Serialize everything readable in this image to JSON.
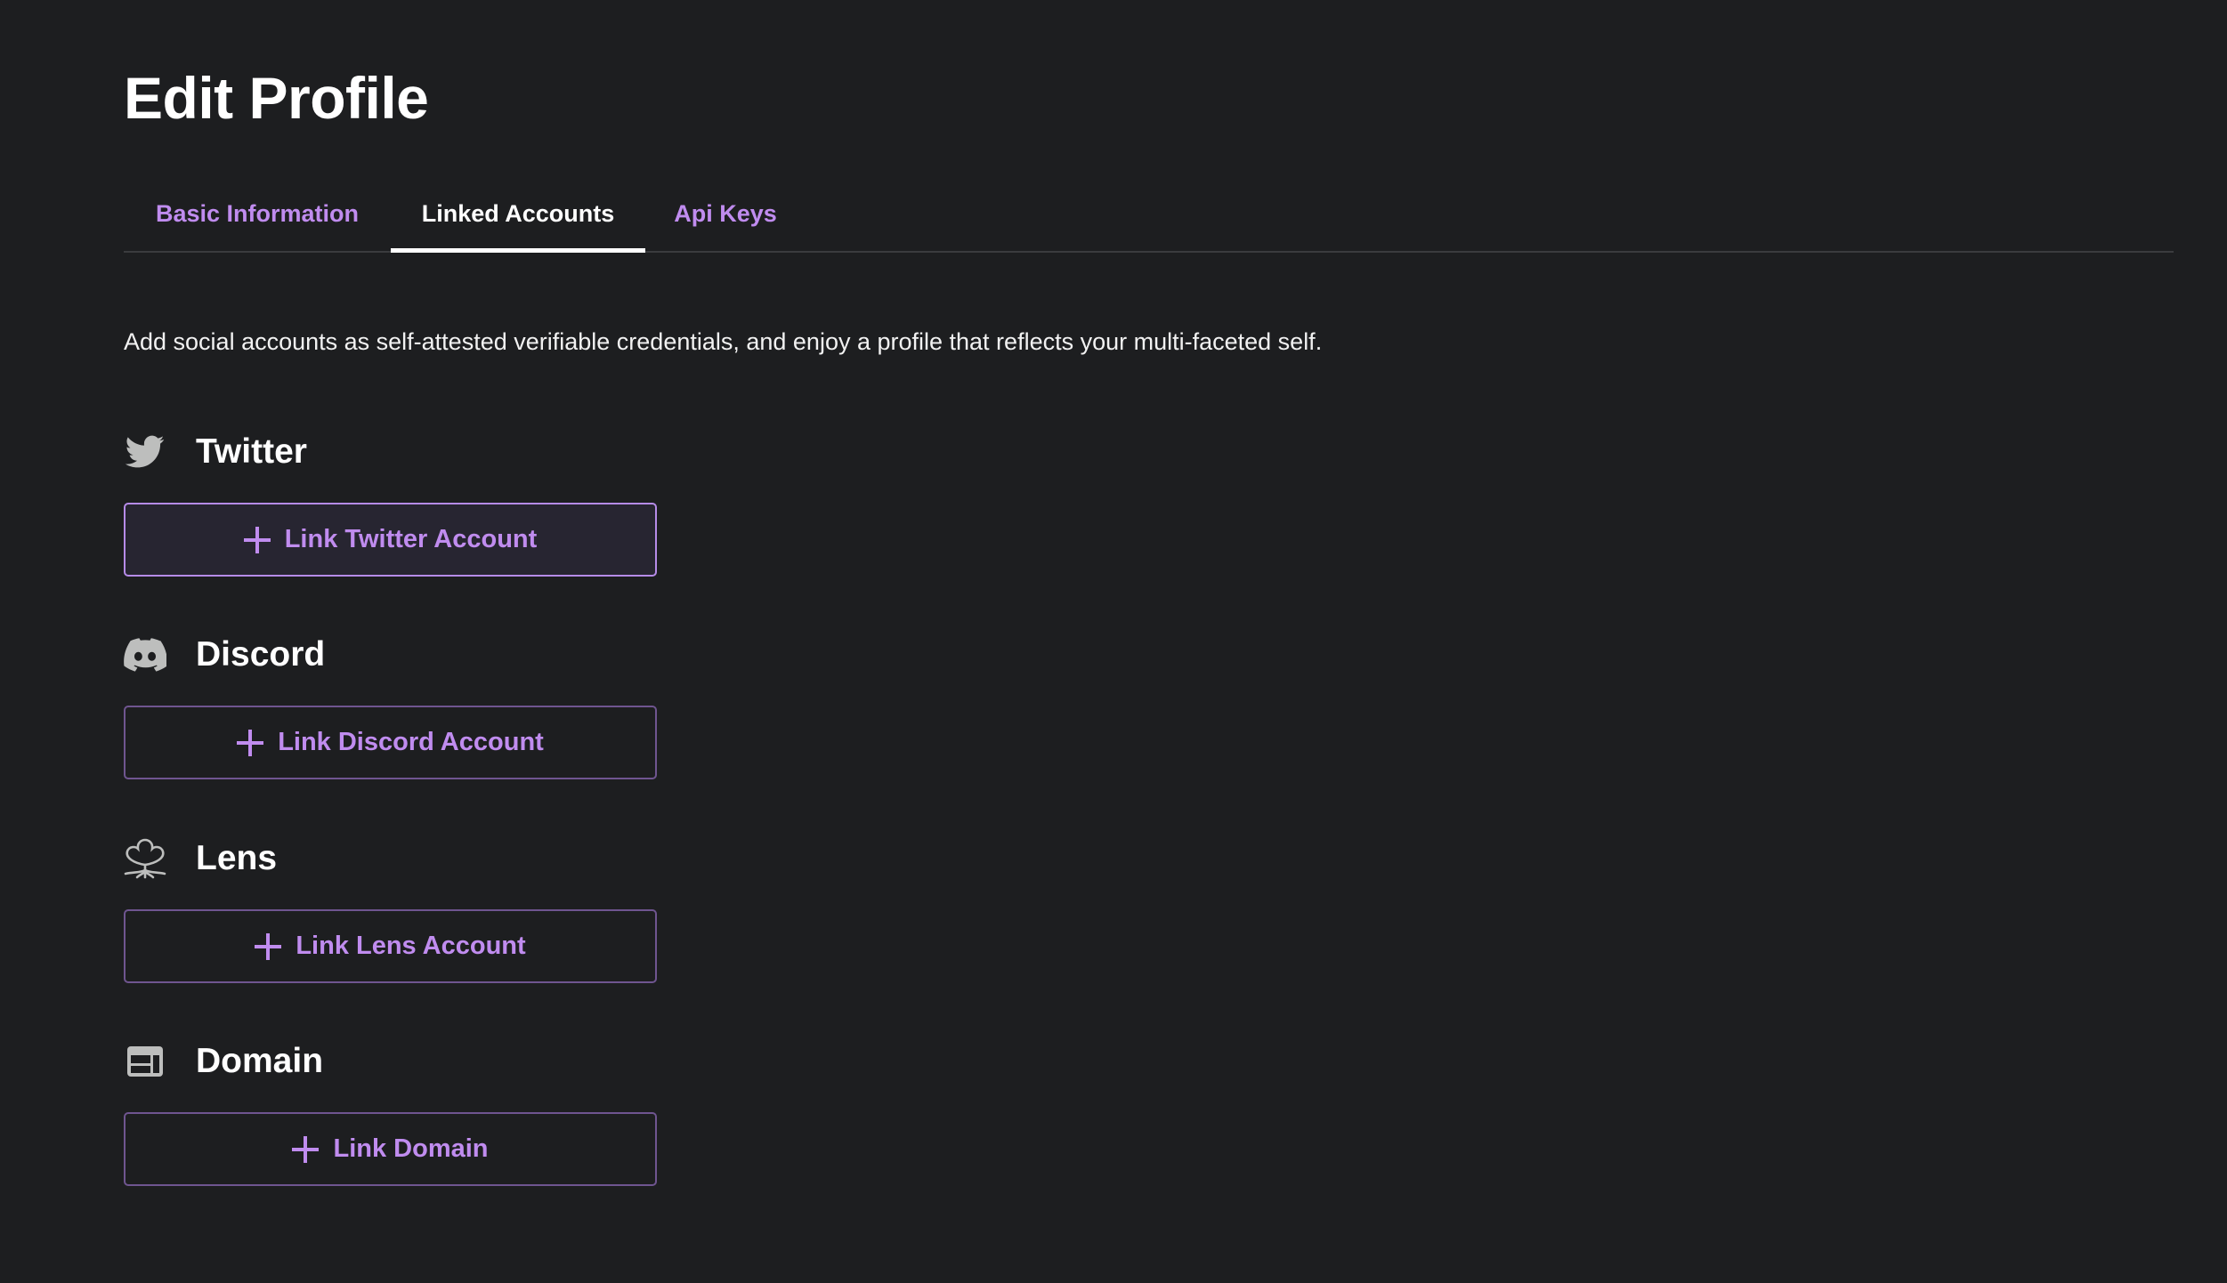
{
  "header": {
    "title": "Edit Profile"
  },
  "tabs": [
    {
      "label": "Basic Information",
      "active": false
    },
    {
      "label": "Linked Accounts",
      "active": true
    },
    {
      "label": "Api Keys",
      "active": false
    }
  ],
  "description": "Add social accounts as self-attested verifiable credentials, and enjoy a profile that reflects your multi-faceted self.",
  "colors": {
    "background": "#1d1e20",
    "accent": "#c08cef",
    "icon_gray": "#bdbebd",
    "button_border": "#6f5590",
    "button_border_hover": "#b68be8"
  },
  "sections": [
    {
      "title": "Twitter",
      "icon": "twitter-bird-icon",
      "button_icon": "plus-icon",
      "button_label": "Link Twitter Account",
      "hovered": true
    },
    {
      "title": "Discord",
      "icon": "discord-logo-icon",
      "button_icon": "plus-icon",
      "button_label": "Link Discord Account",
      "hovered": false
    },
    {
      "title": "Lens",
      "icon": "lens-protocol-icon",
      "button_icon": "plus-icon",
      "button_label": "Link Lens Account",
      "hovered": false
    },
    {
      "title": "Domain",
      "icon": "domain-layout-icon",
      "button_icon": "plus-icon",
      "button_label": "Link Domain",
      "hovered": false
    }
  ]
}
